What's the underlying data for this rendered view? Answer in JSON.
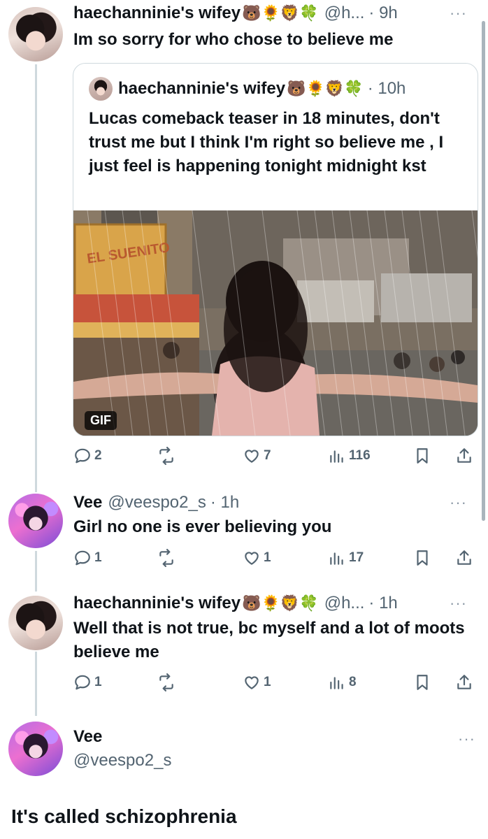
{
  "tweets": [
    {
      "name": "haechanninie's wifey",
      "emojis": "🐻🌻🦁🍀",
      "handle": "@h...",
      "time": "· 9h",
      "text": "Im so sorry for who chose to believe me",
      "quote": {
        "name": "haechanninie's wifey",
        "emojis": "🐻🌻🦁🍀",
        "time": "· 10h",
        "text": "Lucas comeback teaser in 18 minutes, don't trust me but I think I'm right so believe me , I just feel is happening tonight midnight kst",
        "media_badge": "GIF",
        "sign_text": "EL SUENITO"
      },
      "stats": {
        "replies": "2",
        "retweets": "",
        "likes": "7",
        "views": "116"
      }
    },
    {
      "name": "Vee",
      "handle": "@veespo2_s",
      "time": "· 1h",
      "text": "Girl no one is ever believing you",
      "stats": {
        "replies": "1",
        "retweets": "",
        "likes": "1",
        "views": "17"
      }
    },
    {
      "name": "haechanninie's wifey",
      "emojis": "🐻🌻🦁🍀",
      "handle": "@h...",
      "time": "· 1h",
      "text": "Well that is not true, bc myself and a lot of moots believe me",
      "stats": {
        "replies": "1",
        "retweets": "",
        "likes": "1",
        "views": "8"
      }
    },
    {
      "name": "Vee",
      "handle": "@veespo2_s",
      "text": "It's called schizophrenia"
    }
  ],
  "more_icon": "···",
  "colors": {
    "text": "#0f1419",
    "secondary": "#536471",
    "border": "#cfd9de"
  }
}
